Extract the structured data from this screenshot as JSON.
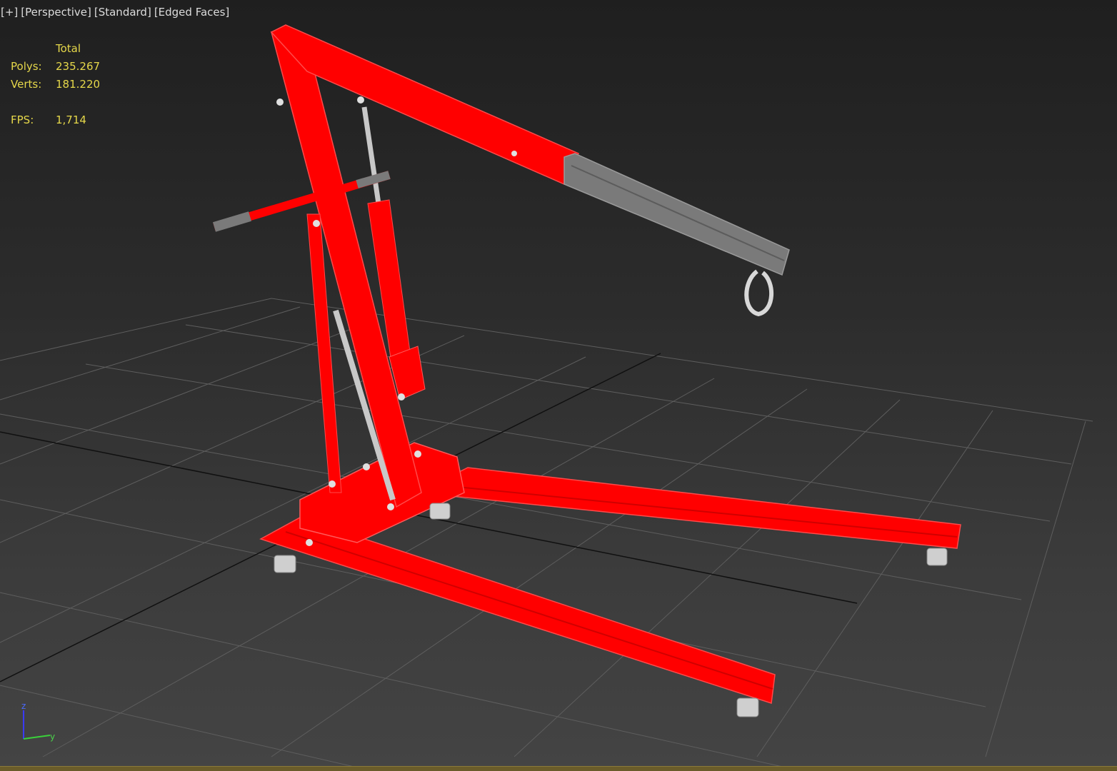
{
  "viewport": {
    "labels": [
      "[+]",
      "[Perspective]",
      "[Standard]",
      "[Edged Faces]"
    ]
  },
  "stats": {
    "header": "Total",
    "polys_label": "Polys:",
    "polys_value": "235.267",
    "verts_label": "Verts:",
    "verts_value": "181.220",
    "fps_label": "FPS:",
    "fps_value": "1,714"
  },
  "axis_gizmo": {
    "z": "z",
    "y": "y"
  },
  "colors": {
    "stats_text": "#e6d84a",
    "model_red": "#ff0000",
    "boom_grey": "#7a7a7a",
    "grid": "#5a5a5a"
  }
}
